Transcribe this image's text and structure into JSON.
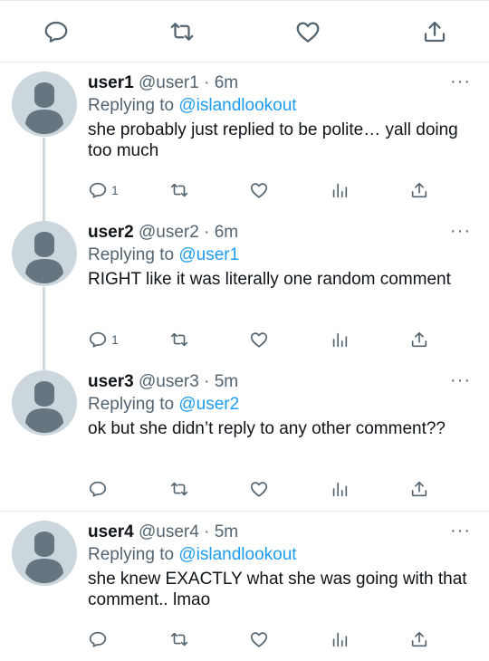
{
  "colors": {
    "icon": "#536471",
    "mention": "#1d9bf0",
    "divider": "#e6ecf0",
    "avatar_bg": "#ccd6dd",
    "avatar_fg": "#66757f"
  },
  "top_actions": [
    "reply-icon",
    "retweet-icon",
    "like-icon",
    "share-icon"
  ],
  "replies": [
    {
      "name": "user1",
      "handle": "@user1",
      "sep": "·",
      "time": "6m",
      "replying_prefix": "Replying to",
      "replying_to": "@islandlookout",
      "text": "she probably just replied to be polite… yall doing too much",
      "reply_count": "1",
      "more": "···"
    },
    {
      "name": "user2",
      "handle": "@user2",
      "sep": "·",
      "time": "6m",
      "replying_prefix": "Replying to",
      "replying_to": "@user1",
      "text": "RIGHT like it was literally one random comment",
      "reply_count": "1",
      "more": "···"
    },
    {
      "name": "user3",
      "handle": "@user3",
      "sep": "·",
      "time": "5m",
      "replying_prefix": "Replying to",
      "replying_to": "@user2",
      "text": "ok but she didn’t reply to any other comment??",
      "reply_count": "",
      "more": "···"
    },
    {
      "name": "user4",
      "handle": "@user4",
      "sep": "·",
      "time": "5m",
      "replying_prefix": "Replying to",
      "replying_to": "@islandlookout",
      "text": "she knew EXACTLY what she was going with that comment.. lmao",
      "reply_count": "",
      "more": "···"
    }
  ]
}
